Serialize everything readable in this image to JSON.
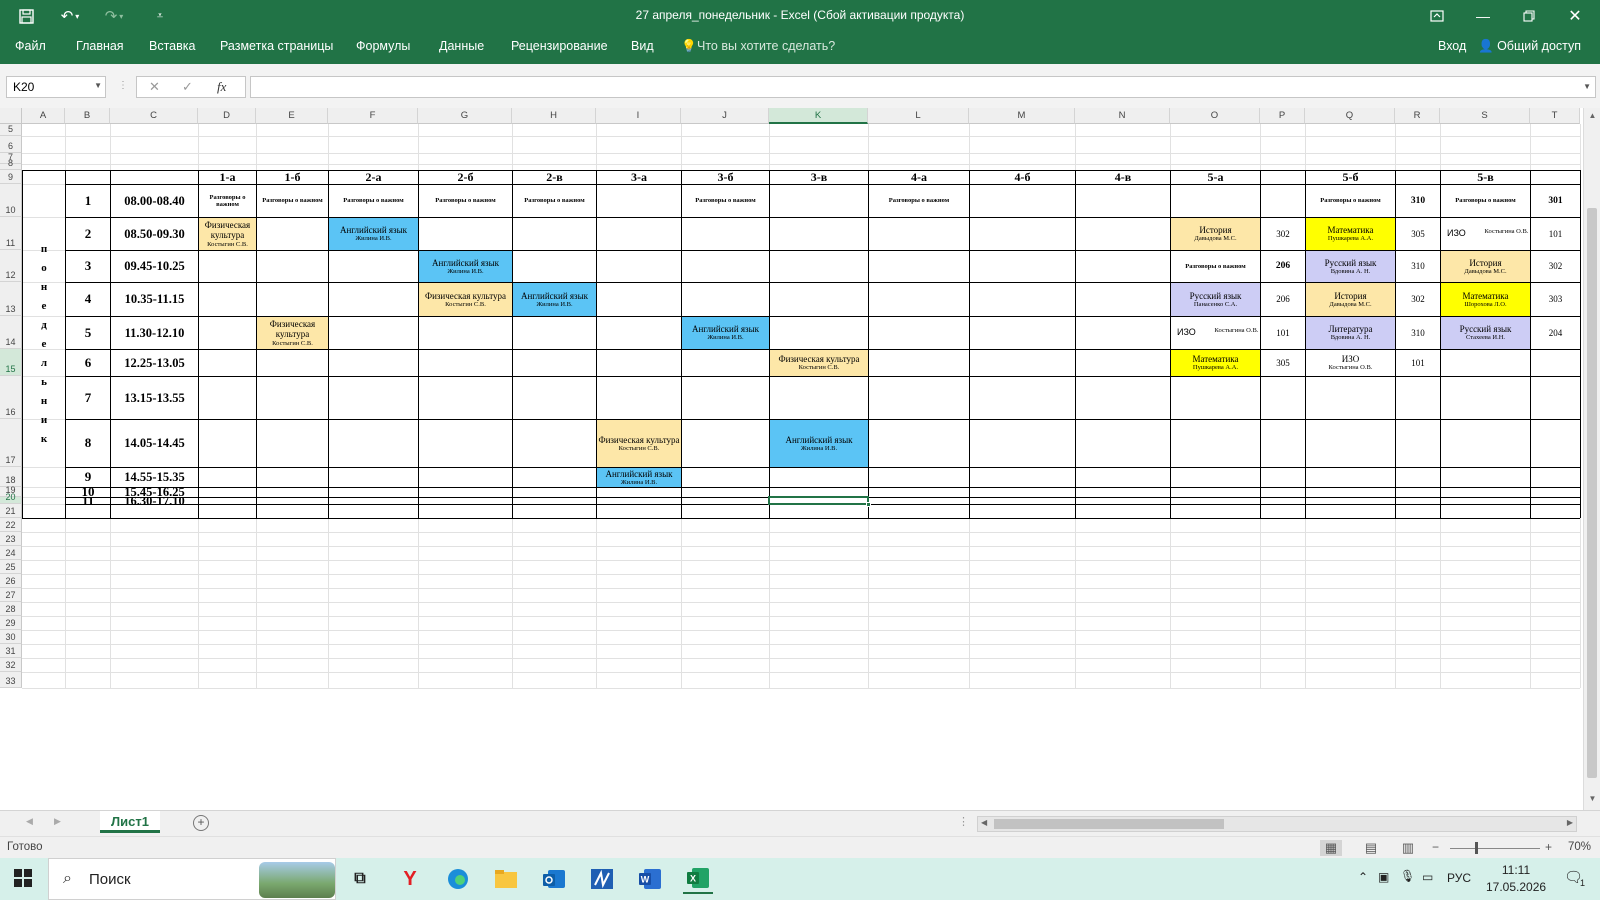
{
  "window": {
    "title": "27 апреля_понедельник - Excel (Сбой активации продукта)"
  },
  "ribbon": {
    "tabs": [
      "Файл",
      "Главная",
      "Вставка",
      "Разметка страницы",
      "Формулы",
      "Данные",
      "Рецензирование",
      "Вид"
    ],
    "tell_me": "Что вы хотите сделать?",
    "login": "Вход",
    "share": "Общий доступ"
  },
  "formula_bar": {
    "name_box": "K20",
    "fx": "fx",
    "content": ""
  },
  "column_headers": [
    "A",
    "B",
    "C",
    "D",
    "E",
    "F",
    "G",
    "H",
    "I",
    "J",
    "K",
    "L",
    "M",
    "N",
    "O",
    "P",
    "Q",
    "R",
    "S",
    "T"
  ],
  "selected_column": "K",
  "row_headers": [
    "5",
    "6",
    "7",
    "8",
    "9",
    "10",
    "11",
    "12",
    "13",
    "14",
    "15",
    "16",
    "17",
    "18",
    "19",
    "20",
    "21",
    "22",
    "23",
    "24",
    "25",
    "26",
    "27",
    "28",
    "29",
    "30",
    "31",
    "32",
    "33"
  ],
  "highlighted_rows": [
    "15",
    "20"
  ],
  "schedule": {
    "day_letters": [
      "п",
      "о",
      "н",
      "е",
      "д",
      "е",
      "л",
      "ь",
      "н",
      "и",
      "к"
    ],
    "classes": [
      "1-а",
      "1-б",
      "2-а",
      "2-б",
      "2-в",
      "3-а",
      "3-б",
      "3-в",
      "4-а",
      "4-б",
      "4-в",
      "5-а",
      "5-б",
      "5-в"
    ],
    "lessons": [
      {
        "n": "1",
        "time": "08.00-08.40"
      },
      {
        "n": "2",
        "time": "08.50-09.30"
      },
      {
        "n": "3",
        "time": "09.45-10.25"
      },
      {
        "n": "4",
        "time": "10.35-11.15"
      },
      {
        "n": "5",
        "time": "11.30-12.10"
      },
      {
        "n": "6",
        "time": "12.25-13.05"
      },
      {
        "n": "7",
        "time": "13.15-13.55"
      },
      {
        "n": "8",
        "time": "14.05-14.45"
      },
      {
        "n": "9",
        "time": "14.55-15.35"
      },
      {
        "n": "10",
        "time": "15.45-16.25"
      },
      {
        "n": "11",
        "time": "16.30-17.10"
      }
    ],
    "razg": "Разговоры о важном",
    "rooms": {
      "r310": "310",
      "r301": "301",
      "r302": "302",
      "r305": "305",
      "r101": "101",
      "r206": "206",
      "r303": "303",
      "r204": "204"
    },
    "entries": {
      "fk": "Физическая культура",
      "fk_d": "Физическая культура",
      "kost": "Костыгин С.В.",
      "eng": "Английский язык",
      "zhil": "Жилина И.В.",
      "hist": "История",
      "dav": "Давыдова М.С.",
      "math": "Математика",
      "push": "Пушкарева А.А.",
      "shor": "Шорохова Л.О.",
      "izo": "ИЗО",
      "kostygina": "Костыгина О.В.",
      "rus": "Русский язык",
      "vdov": "Вдовина А. Н.",
      "pan": "Панасенко С.А.",
      "stah": "Стахеева И.Н.",
      "lit": "Литература"
    }
  },
  "sheet_tabs": [
    "Лист1"
  ],
  "status": {
    "ready": "Готово",
    "zoom": "70%"
  },
  "taskbar": {
    "search_placeholder": "Поиск",
    "lang": "РУС",
    "time": "11:11",
    "date": "17.05.2026",
    "notifications": "1"
  },
  "colors": {
    "excel_green": "#217346",
    "blue_cell": "#5bc4f5",
    "beige_cell": "#fde7a8",
    "yellow_cell": "#ffff00",
    "lavender_cell": "#cdcdf5"
  }
}
